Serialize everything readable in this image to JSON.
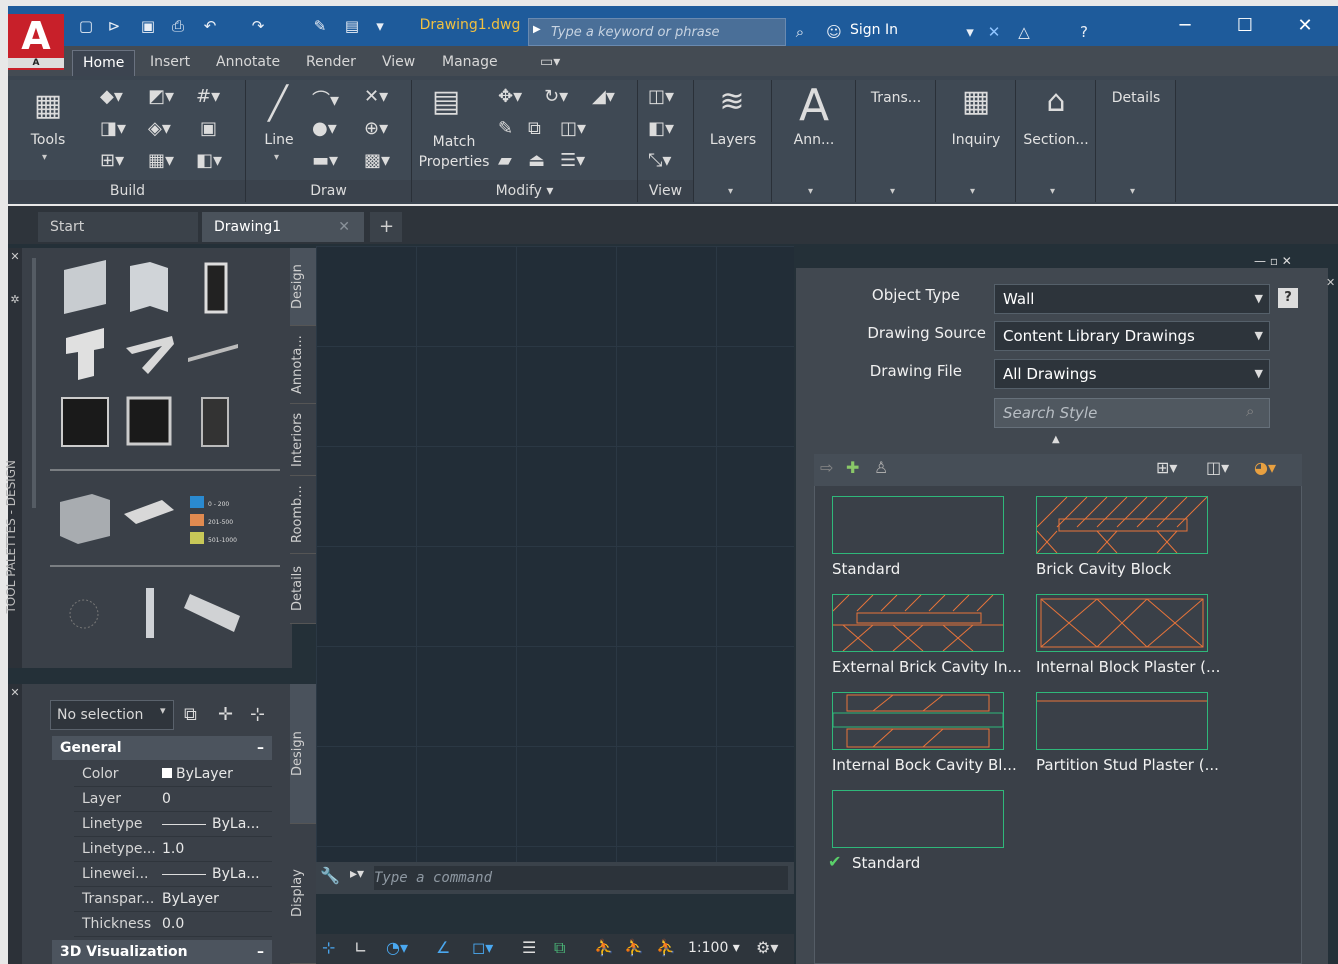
{
  "titlebar": {
    "logo_letter": "A",
    "logo_sub": "A",
    "doc_title": "Drawing1.dwg",
    "search_placeholder": "Type a keyword or phrase",
    "sign_in": "Sign In"
  },
  "ribbon_tabs": [
    "Home",
    "Insert",
    "Annotate",
    "Render",
    "View",
    "Manage"
  ],
  "ribbon": {
    "tools": "Tools",
    "build": "Build",
    "line": "Line",
    "draw": "Draw",
    "match_properties_1": "Match",
    "match_properties_2": "Properties",
    "modify": "Modify",
    "view": "View",
    "layers": "Layers",
    "ann": "Ann...",
    "trans": "Trans...",
    "inquiry": "Inquiry",
    "section": "Section...",
    "details": "Details"
  },
  "doc_tabs": {
    "start": "Start",
    "drawing": "Drawing1"
  },
  "tool_palette": {
    "side_label": "TOOL PALETTES - DESIGN",
    "tabs": [
      "Design",
      "Annota...",
      "Interiors",
      "Roomb...",
      "Details"
    ],
    "legend": [
      "0 - 200",
      "201-500",
      "501-1000"
    ]
  },
  "properties": {
    "selection": "No selection",
    "general_section": "General",
    "rows": [
      {
        "key": "Color",
        "value": "ByLayer"
      },
      {
        "key": "Layer",
        "value": "0"
      },
      {
        "key": "Linetype",
        "value": "ByLa..."
      },
      {
        "key": "Linetype...",
        "value": "1.0"
      },
      {
        "key": "Linewei...",
        "value": "ByLa..."
      },
      {
        "key": "Transpar...",
        "value": "ByLayer"
      },
      {
        "key": "Thickness",
        "value": "0.0"
      }
    ],
    "viz_section": "3D Visualization",
    "tabs": [
      "Design",
      "Display"
    ]
  },
  "command": {
    "placeholder": "Type a command"
  },
  "status": {
    "scale": "1:100"
  },
  "style_browser": {
    "object_type_label": "Object Type",
    "object_type": "Wall",
    "drawing_source_label": "Drawing Source",
    "drawing_source": "Content Library Drawings",
    "drawing_file_label": "Drawing File",
    "drawing_file": "All Drawings",
    "search_placeholder": "Search Style",
    "styles": [
      "Standard",
      "Brick Cavity Block",
      "External Brick Cavity In...",
      "Internal Block Plaster (...",
      "Internal Bock Cavity Bl...",
      "Partition Stud Plaster (...",
      "Standard"
    ]
  },
  "colors": {
    "titlebar": "#1e5b9b",
    "accent_red": "#c8202a",
    "thumb_border": "#2fb87a",
    "hatch": "#e8743a"
  }
}
